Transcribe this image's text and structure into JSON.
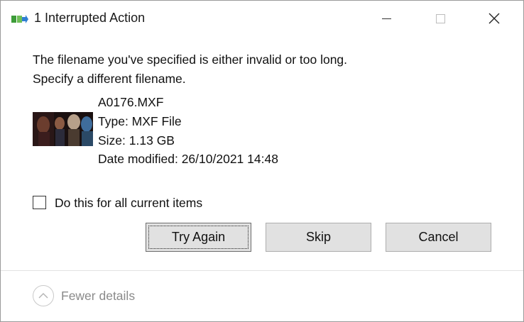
{
  "window": {
    "title": "1 Interrupted Action",
    "controls": [
      "minimize",
      "maximize",
      "close"
    ]
  },
  "message": {
    "line1": "The filename you've specified is either invalid or too long.",
    "line2": "Specify a different filename."
  },
  "file": {
    "name": "A0176.MXF",
    "type": "Type: MXF File",
    "size": "Size: 1.13 GB",
    "date_modified": "Date modified: 26/10/2021 14:48"
  },
  "apply_all": {
    "label": "Do this for all current items",
    "checked": false
  },
  "buttons": {
    "try_again": "Try Again",
    "skip": "Skip",
    "cancel": "Cancel"
  },
  "footer": {
    "toggle_label": "Fewer details"
  },
  "icons": {
    "app": "file-move-icon",
    "minimize": "minimize-icon",
    "maximize": "maximize-icon",
    "close": "close-icon",
    "chevron": "chevron-up-icon"
  },
  "colors": {
    "button_bg": "#e1e1e1",
    "disabled_text": "#8a8a8a",
    "icon_green": "#3e9c3a",
    "icon_blue": "#2f7fd3"
  }
}
